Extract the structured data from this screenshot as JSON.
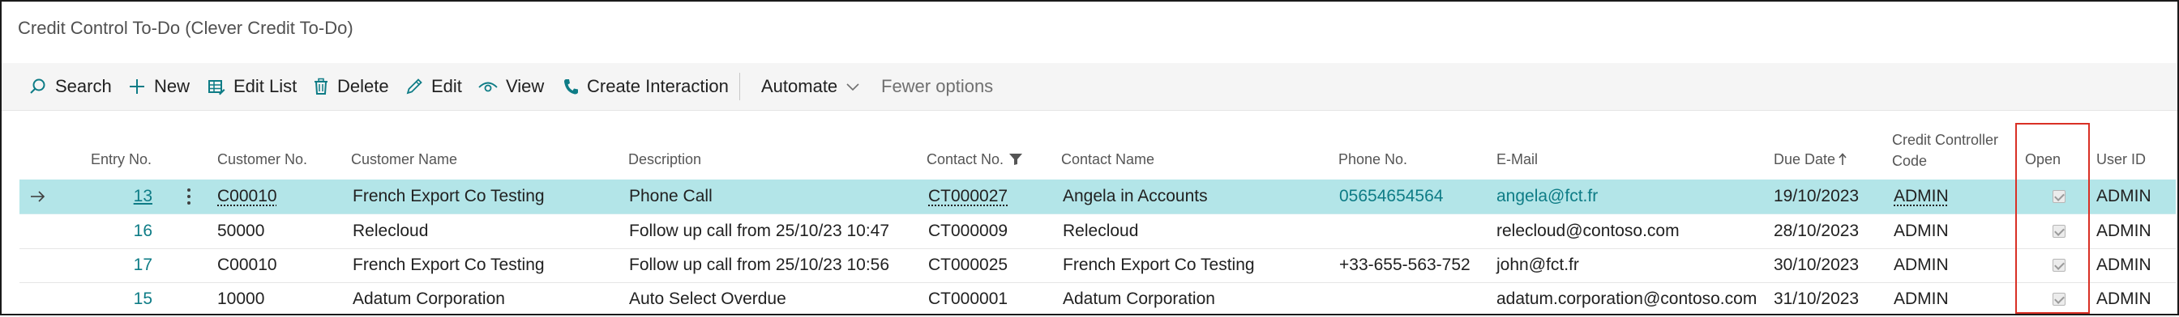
{
  "page": {
    "title": "Credit Control To-Do (Clever Credit To-Do)"
  },
  "toolbar": {
    "search": "Search",
    "new": "New",
    "edit_list": "Edit List",
    "delete": "Delete",
    "edit": "Edit",
    "view": "View",
    "create_interaction": "Create Interaction",
    "automate": "Automate",
    "fewer_options": "Fewer options"
  },
  "columns": {
    "entry_no": "Entry No.",
    "customer_no": "Customer No.",
    "customer_name": "Customer Name",
    "description": "Description",
    "contact_no": "Contact No.",
    "contact_name": "Contact Name",
    "phone_no": "Phone No.",
    "email": "E-Mail",
    "due_date": "Due Date",
    "credit_controller_line1": "Credit Controller",
    "credit_controller_line2": "Code",
    "open": "Open",
    "user_id": "User ID"
  },
  "rows": [
    {
      "entry_no": "13",
      "customer_no": "C00010",
      "customer_name": "French Export Co Testing",
      "description": "Phone Call",
      "contact_no": "CT000027",
      "contact_name": "Angela in Accounts",
      "phone_no": "05654654564",
      "email": "angela@fct.fr",
      "due_date": "19/10/2023",
      "credit_controller": "ADMIN",
      "open": true,
      "user_id": "ADMIN"
    },
    {
      "entry_no": "16",
      "customer_no": "50000",
      "customer_name": "Relecloud",
      "description": "Follow up call from 25/10/23 10:47",
      "contact_no": "CT000009",
      "contact_name": "Relecloud",
      "phone_no": "",
      "email": "relecloud@contoso.com",
      "due_date": "28/10/2023",
      "credit_controller": "ADMIN",
      "open": true,
      "user_id": "ADMIN"
    },
    {
      "entry_no": "17",
      "customer_no": "C00010",
      "customer_name": "French Export Co Testing",
      "description": "Follow up call from 25/10/23 10:56",
      "contact_no": "CT000025",
      "contact_name": "French Export Co Testing",
      "phone_no": "+33-655-563-752",
      "email": "john@fct.fr",
      "due_date": "30/10/2023",
      "credit_controller": "ADMIN",
      "open": true,
      "user_id": "ADMIN"
    },
    {
      "entry_no": "15",
      "customer_no": "10000",
      "customer_name": "Adatum Corporation",
      "description": "Auto Select Overdue",
      "contact_no": "CT000001",
      "contact_name": "Adatum Corporation",
      "phone_no": "",
      "email": "adatum.corporation@contoso.com",
      "due_date": "31/10/2023",
      "credit_controller": "ADMIN",
      "open": true,
      "user_id": "ADMIN"
    }
  ],
  "colors": {
    "accent": "#0e7c86",
    "selected_row": "#b3e5e8",
    "highlight_box": "#d93025"
  },
  "icons": [
    "search-icon",
    "plus-icon",
    "edit-list-icon",
    "trash-icon",
    "pencil-icon",
    "eye-icon",
    "phone-icon",
    "chevron-down-icon",
    "filter-icon",
    "sort-up-icon",
    "arrow-right-icon",
    "more-vertical-icon"
  ]
}
